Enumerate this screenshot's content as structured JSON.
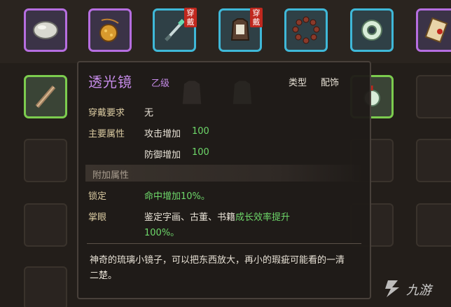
{
  "inventory": {
    "row1": [
      {
        "name": "white-stone-item",
        "rarity": "purple",
        "equipped": false
      },
      {
        "name": "gold-bag-item",
        "rarity": "purple",
        "equipped": false
      },
      {
        "name": "jade-sword-item",
        "rarity": "cyan",
        "equipped": true
      },
      {
        "name": "armor-item",
        "rarity": "cyan",
        "equipped": true
      },
      {
        "name": "bead-bracelet-item",
        "rarity": "cyan",
        "equipped": false
      },
      {
        "name": "jade-ring-item",
        "rarity": "cyan",
        "equipped": false
      },
      {
        "name": "scroll-item",
        "rarity": "purple",
        "equipped": false
      }
    ],
    "equip_tag": "穿戴"
  },
  "tooltip": {
    "name": "透光镜",
    "grade": "乙级",
    "type_label": "类型",
    "type_value": "配饰",
    "wear_req_label": "穿戴要求",
    "wear_req_value": "无",
    "main_attr_label": "主要属性",
    "attr1_name": "攻击增加",
    "attr1_value": "100",
    "attr2_name": "防御增加",
    "attr2_value": "100",
    "extra_section": "附加属性",
    "lock_label": "锁定",
    "lock_value": "命中增加10%。",
    "eye_label": "掌眼",
    "eye_value_prefix": "鉴定字画、古董、书籍",
    "eye_value_highlight": "成长效率提升",
    "eye_value_line2": "100%。",
    "description": "神奇的琉璃小镜子，可以把东西放大，再小的瑕疵可能看的一清二楚。"
  },
  "watermark": {
    "text": "九游"
  },
  "colors": {
    "purple_rarity": "#b66ee0",
    "cyan_rarity": "#3fb8d8",
    "green_rarity": "#7ccc4e",
    "stat_green": "#6ed86a",
    "equip_red": "#c0281e"
  }
}
